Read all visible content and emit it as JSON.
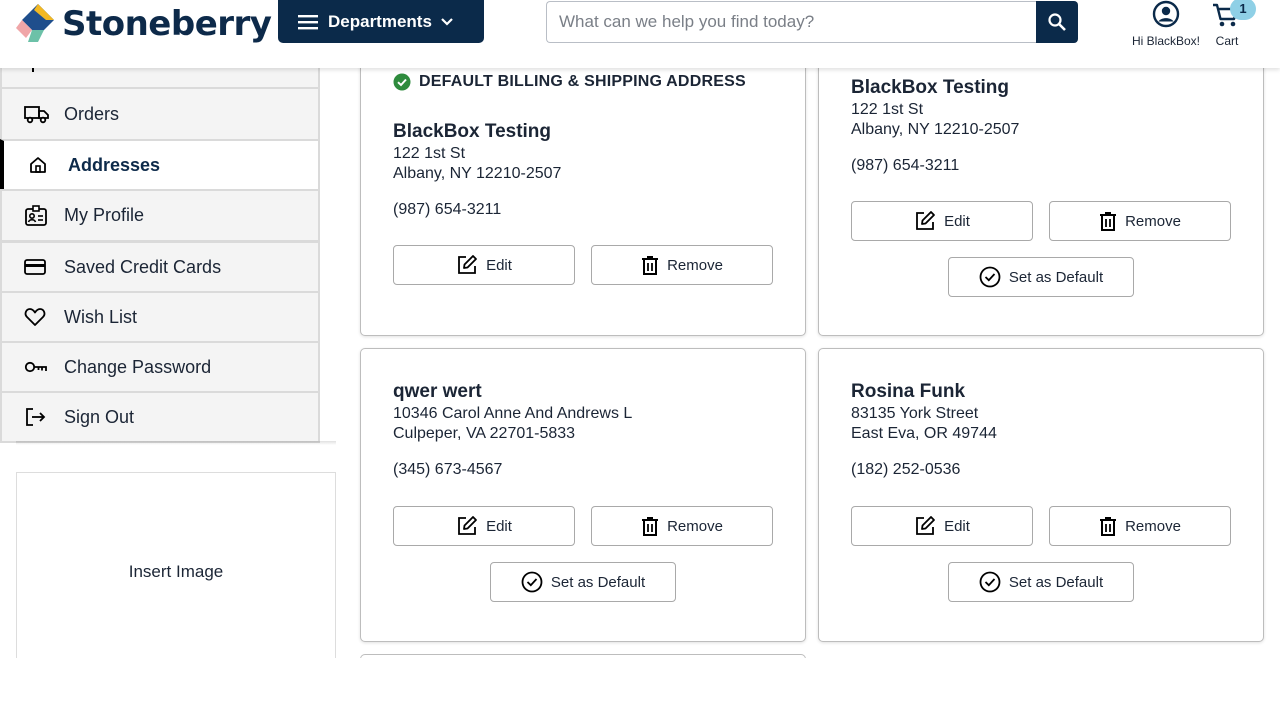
{
  "header": {
    "logo_text": "Stoneberry",
    "departments_label": "Departments",
    "search_placeholder": "What can we help you find today?",
    "account_label": "Hi BlackBox!",
    "cart_label": "Cart",
    "cart_count": "1",
    "brand_color": "#0b2a4a",
    "badge_color": "#8fd0e6"
  },
  "sidebar": {
    "items": [
      {
        "label": "",
        "icon": "activity-icon"
      },
      {
        "label": "Orders",
        "icon": "truck-icon"
      },
      {
        "label": "Addresses",
        "icon": "home-icon",
        "active": true
      },
      {
        "label": "My Profile",
        "icon": "id-card-icon"
      },
      {
        "label": "Saved Credit Cards",
        "icon": "credit-card-icon"
      },
      {
        "label": "Wish List",
        "icon": "heart-icon"
      },
      {
        "label": "Change Password",
        "icon": "key-icon"
      },
      {
        "label": "Sign Out",
        "icon": "sign-out-icon"
      }
    ],
    "insert_image": "Insert Image"
  },
  "addresses": {
    "default_label": "DEFAULT BILLING & SHIPPING ADDRESS",
    "edit_label": "Edit",
    "remove_label": "Remove",
    "set_default_label": "Set as Default",
    "cards": [
      {
        "name": "BlackBox Testing",
        "street": "122 1st St",
        "city": "Albany, NY 12210-2507",
        "phone": "(987) 654-3211",
        "is_default": true
      },
      {
        "name": "BlackBox Testing",
        "street": "122 1st St",
        "city": "Albany, NY 12210-2507",
        "phone": "(987) 654-3211",
        "is_default": false
      },
      {
        "name": "qwer wert",
        "street": "10346 Carol Anne And Andrews L",
        "city": "Culpeper, VA 22701-5833",
        "phone": "(345) 673-4567",
        "is_default": false
      },
      {
        "name": "Rosina Funk",
        "street": "83135 York Street",
        "city": "East Eva, OR 49744",
        "phone": "(182) 252-0536",
        "is_default": false
      }
    ]
  }
}
